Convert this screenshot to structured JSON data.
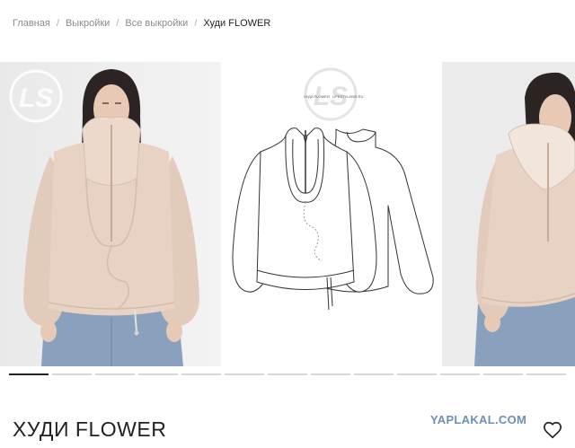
{
  "breadcrumb": {
    "items": [
      "Главная",
      "Выкройки",
      "Все выкройки"
    ],
    "current": "Худи FLOWER",
    "separator": "/"
  },
  "gallery": {
    "slides": [
      {
        "kind": "model-photo-front"
      },
      {
        "kind": "technical-sketch",
        "caption_left": "ХУДИ FLOWER",
        "caption_right": "LIFESTYLEBIS.RU"
      },
      {
        "kind": "model-photo-side"
      }
    ],
    "logo_text": "LS",
    "dot_count": 13,
    "active_index": 0
  },
  "product": {
    "title": "ХУДИ FLOWER"
  },
  "watermark": "YAPLAKAL.COM",
  "icons": {
    "favorite": "heart-icon"
  },
  "colors": {
    "fleece": "#e6cfbf",
    "jeans": "#8aa1bd",
    "watermark": "#6c8fb8"
  }
}
